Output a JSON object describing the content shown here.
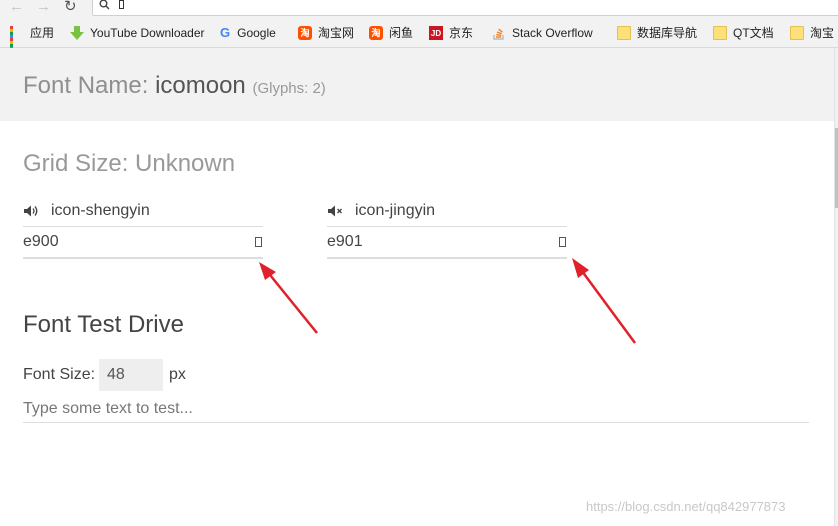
{
  "bookmarks": [
    {
      "label": "应用",
      "icon": "apps-grid-icon"
    },
    {
      "label": "YouTube Downloader",
      "icon": "download-arrow-icon"
    },
    {
      "label": "Google",
      "icon": "google-g-icon"
    },
    {
      "label": "淘宝网",
      "icon": "taobao-icon"
    },
    {
      "label": "闲鱼",
      "icon": "taobao-icon"
    },
    {
      "label": "京东",
      "icon": "jd-icon"
    },
    {
      "label": "Stack Overflow",
      "icon": "stackoverflow-icon"
    },
    {
      "label": "数据库导航",
      "icon": "folder-icon"
    },
    {
      "label": "QT文档",
      "icon": "folder-icon"
    },
    {
      "label": "淘宝",
      "icon": "folder-icon"
    }
  ],
  "header": {
    "font_name_label": "Font Name:",
    "font_name_value": "icomoon",
    "glyph_count": "(Glyphs: 2)"
  },
  "grid_size": "Grid Size: Unknown",
  "glyphs": [
    {
      "name": "icon-shengyin",
      "code": "e900",
      "icon": "speaker-icon"
    },
    {
      "name": "icon-jingyin",
      "code": "e901",
      "icon": "mute-speaker-icon"
    }
  ],
  "test_drive": {
    "title": "Font Test Drive",
    "size_label": "Font Size:",
    "size_value": "48",
    "size_unit": "px",
    "text_placeholder": "Type some text to test..."
  },
  "watermark": "https://blog.csdn.net/qq842977873",
  "colors": {
    "arrow": "#e0202a",
    "header_bg": "#f2f2f2"
  }
}
